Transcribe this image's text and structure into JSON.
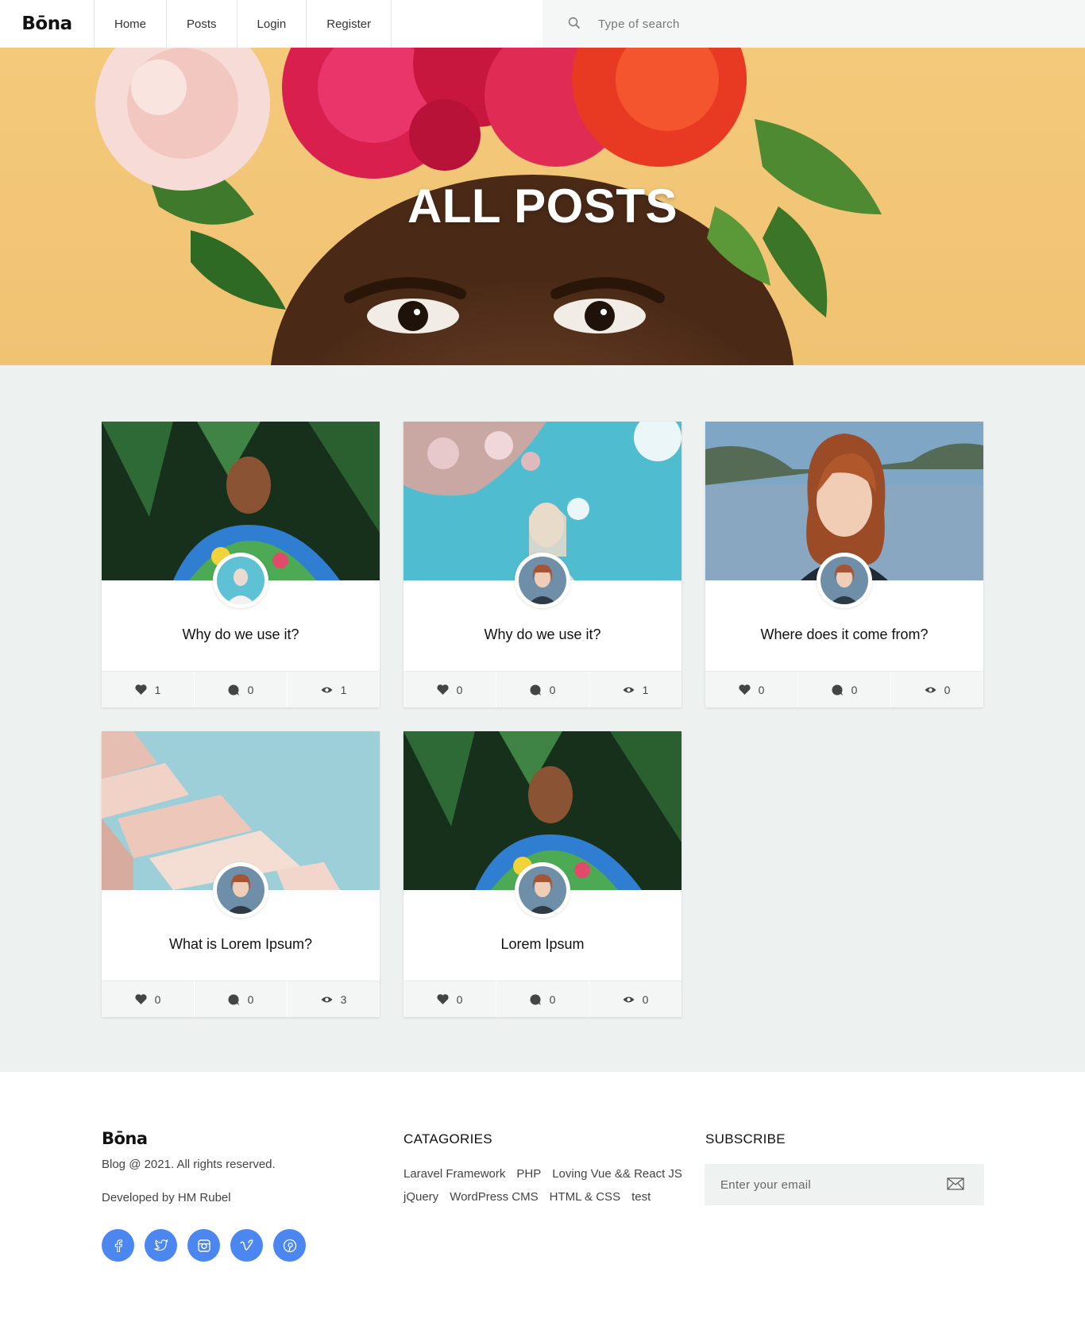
{
  "header": {
    "logo": "Bōna",
    "nav": [
      "Home",
      "Posts",
      "Login",
      "Register"
    ],
    "search_placeholder": "Type of search"
  },
  "hero": {
    "title": "ALL POSTS"
  },
  "posts": [
    {
      "title": "Why do we use it?",
      "likes": "1",
      "comments": "0",
      "views": "1"
    },
    {
      "title": "Why do we use it?",
      "likes": "0",
      "comments": "0",
      "views": "1"
    },
    {
      "title": "Where does it come from?",
      "likes": "0",
      "comments": "0",
      "views": "0"
    },
    {
      "title": "What is Lorem Ipsum?",
      "likes": "0",
      "comments": "0",
      "views": "3"
    },
    {
      "title": "Lorem Ipsum",
      "likes": "0",
      "comments": "0",
      "views": "0"
    }
  ],
  "footer": {
    "logo": "Bōna",
    "copyright": "Blog @ 2021. All rights reserved.",
    "developer": "Developed by HM Rubel",
    "social_icons": [
      "facebook-icon",
      "twitter-icon",
      "instagram-icon",
      "vimeo-icon",
      "pinterest-icon"
    ],
    "categories_heading": "CATAGORIES",
    "categories": [
      "Laravel Framework",
      "PHP",
      "Loving Vue && React JS",
      "jQuery",
      "WordPress CMS",
      "HTML & CSS",
      "test"
    ],
    "subscribe_heading": "SUBSCRIBE",
    "subscribe_placeholder": "Enter your email"
  },
  "colors": {
    "accent": "#4c86f0",
    "section_bg": "#edf2f1",
    "hero_bg": "#f4c97a"
  }
}
